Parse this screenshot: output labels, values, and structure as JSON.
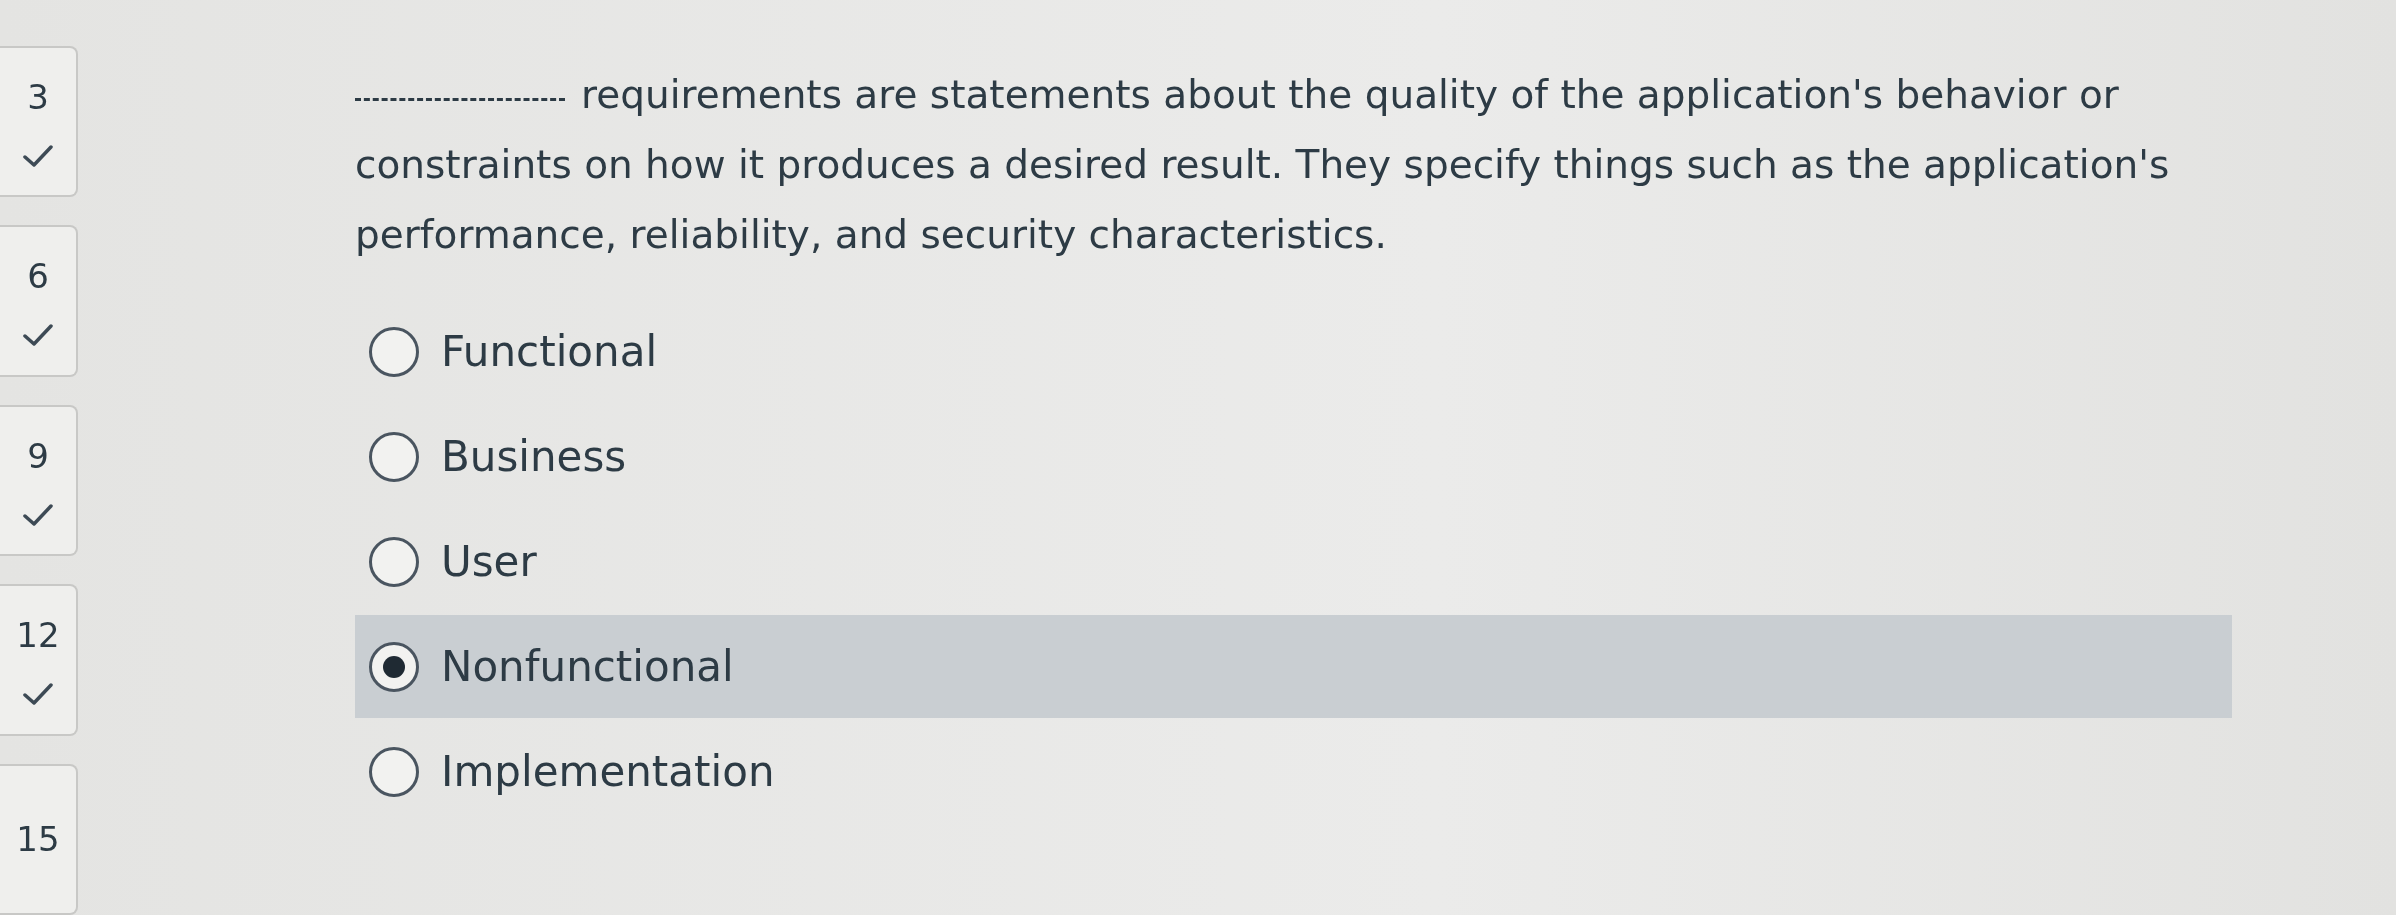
{
  "question_nav": [
    {
      "number": "3",
      "answered": true
    },
    {
      "number": "6",
      "answered": true
    },
    {
      "number": "9",
      "answered": true
    },
    {
      "number": "12",
      "answered": true
    },
    {
      "number": "15",
      "answered": false
    }
  ],
  "question": {
    "blank": true,
    "text": "requirements are statements about the quality of the application's behavior or constraints on how it produces a desired result. They specify things such as the application's performance, reliability, and security characteristics."
  },
  "options": [
    {
      "label": "Functional",
      "selected": false
    },
    {
      "label": "Business",
      "selected": false
    },
    {
      "label": "User",
      "selected": false
    },
    {
      "label": "Nonfunctional",
      "selected": true
    },
    {
      "label": "Implementation",
      "selected": false
    }
  ]
}
